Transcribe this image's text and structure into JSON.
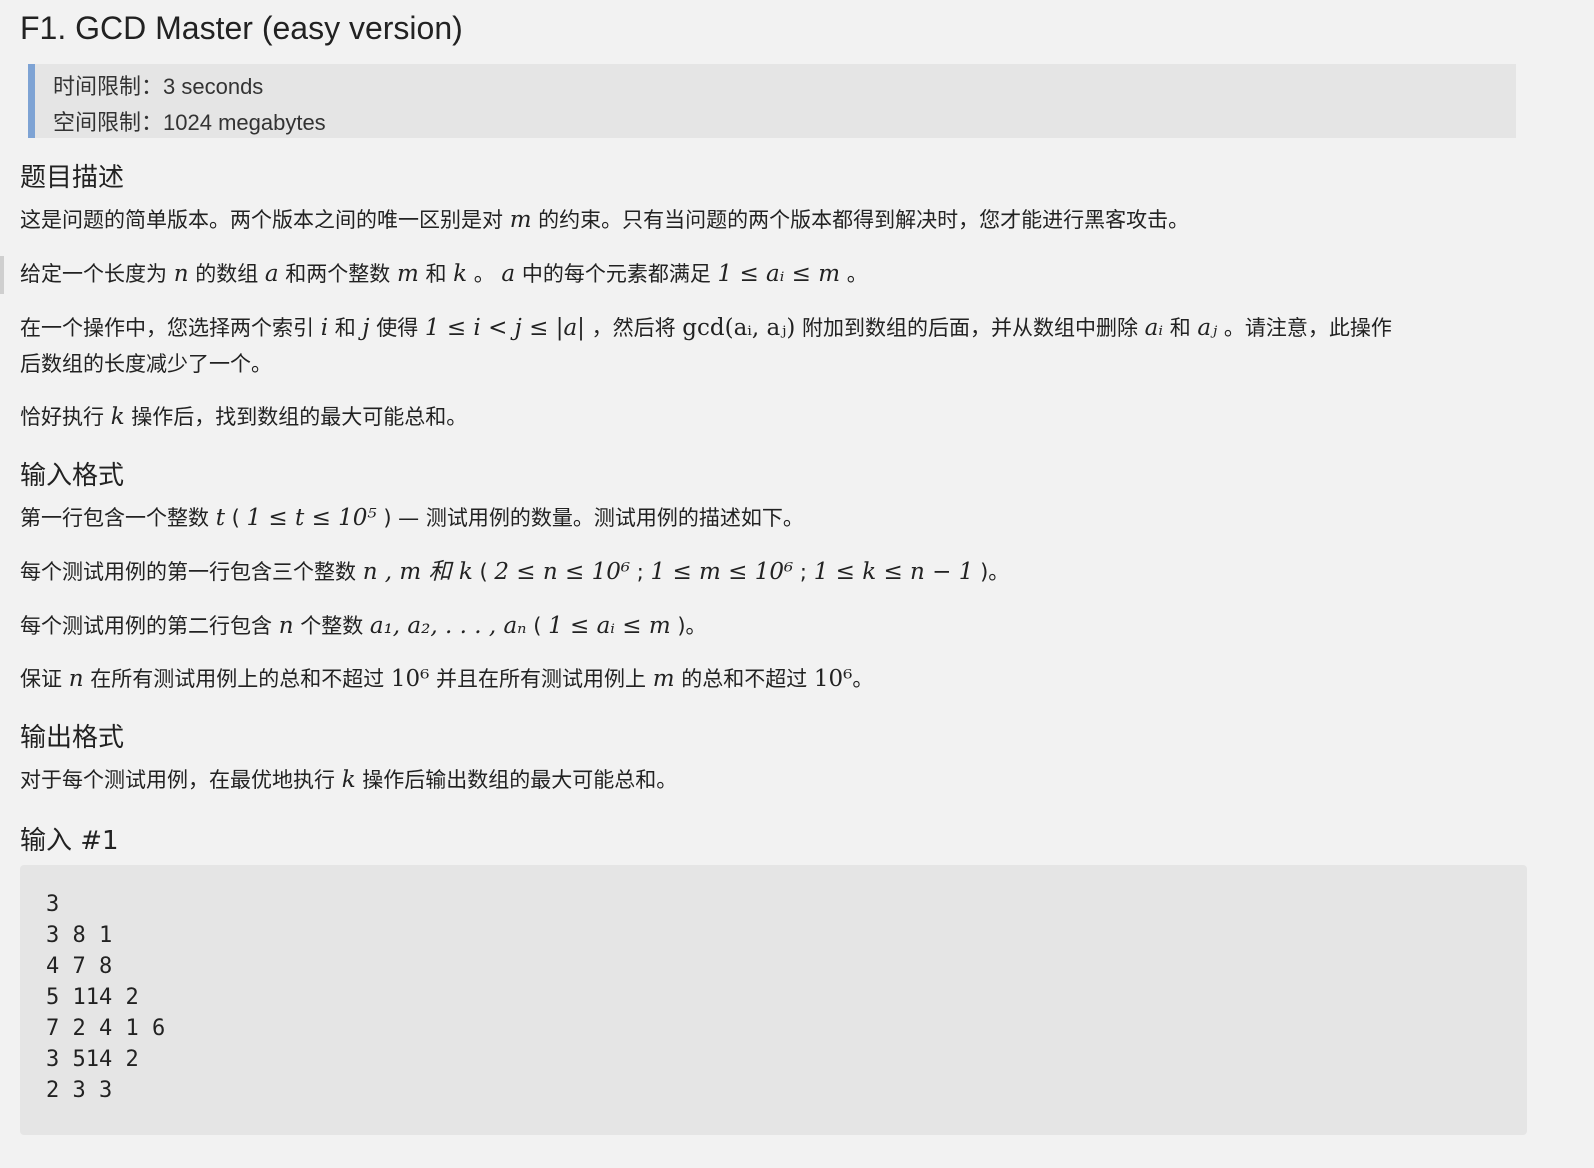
{
  "problem": {
    "title": "F1. GCD Master (easy version)",
    "limits": {
      "time_label": "时间限制：",
      "time_value": "3 seconds",
      "memory_label": "空间限制：",
      "memory_value": "1024 megabytes"
    }
  },
  "sections": {
    "description_heading": "题目描述",
    "input_heading": "输入格式",
    "output_heading": "输出格式",
    "example_heading": "输入 #1"
  },
  "description": {
    "p1_a": "这是问题的简单版本。两个版本之间的唯一区别是对 ",
    "p1_m": "m",
    "p1_b": " 的约束。只有当问题的两个版本都得到解决时，您才能进行黑客攻击。",
    "p2_a": "给定一个长度为 ",
    "p2_n": "n",
    "p2_b": " 的数组 ",
    "p2_arr": "a",
    "p2_c": " 和两个整数 ",
    "p2_m": "m",
    "p2_d": " 和 ",
    "p2_k": "k",
    "p2_e": " 。 ",
    "p2_arr2": "a",
    "p2_f": " 中的每个元素都满足 ",
    "p2_math": "1 ≤ aᵢ ≤ m",
    "p2_g": " 。",
    "p3_a": "在一个操作中，您选择两个索引 ",
    "p3_i": "i",
    "p3_b": " 和 ",
    "p3_j": "j",
    "p3_c": " 使得 ",
    "p3_math": "1 ≤ i < j ≤ |a|",
    "p3_d": " ，然后将 ",
    "p3_gcd": "gcd(aᵢ, aⱼ)",
    "p3_e": " 附加到数组的后面，并从数组中删除 ",
    "p3_ai": "aᵢ",
    "p3_f": " 和 ",
    "p3_aj": "aⱼ",
    "p3_g": " 。请注意，此操作",
    "p3_line2": "后数组的长度减少了一个。",
    "p4_a": "恰好执行 ",
    "p4_k": "k",
    "p4_b": " 操作后，找到数组的最大可能总和。"
  },
  "input_format": {
    "l1_a": "第一行包含一个整数 ",
    "l1_t": "t",
    "l1_b": " ( ",
    "l1_math": "1 ≤ t ≤ 10⁵",
    "l1_c": " ) — 测试用例的数量。测试用例的描述如下。",
    "l2_a": "每个测试用例的第一行包含三个整数 ",
    "l2_vars": "n , m 和 k",
    "l2_b": " ( ",
    "l2_math1": "2 ≤ n ≤ 10⁶",
    "l2_sep1": " ; ",
    "l2_math2": "1 ≤ m ≤ 10⁶",
    "l2_sep2": " ; ",
    "l2_math3": "1 ≤ k ≤ n − 1",
    "l2_c": " )。",
    "l3_a": "每个测试用例的第二行包含 ",
    "l3_n": "n",
    "l3_b": " 个整数 ",
    "l3_seq": "a₁, a₂, . . . , aₙ",
    "l3_c": " ( ",
    "l3_math": "1 ≤ aᵢ ≤ m",
    "l3_d": " )。",
    "l4_a": "保证 ",
    "l4_n": "n",
    "l4_b": " 在所有测试用例上的总和不超过 ",
    "l4_p1": "10⁶",
    "l4_c": " 并且在所有测试用例上 ",
    "l4_m": "m",
    "l4_d": " 的总和不超过 ",
    "l4_p2": "10⁶",
    "l4_e": "。"
  },
  "output_format": {
    "l1_a": "对于每个测试用例，在最优地执行 ",
    "l1_k": "k",
    "l1_b": " 操作后输出数组的最大可能总和。"
  },
  "example": {
    "lines": [
      "3",
      "3 8 1",
      "4 7 8",
      "5 114 2",
      "7 2 4 1 6",
      "3 514 2",
      "2 3 3"
    ]
  }
}
